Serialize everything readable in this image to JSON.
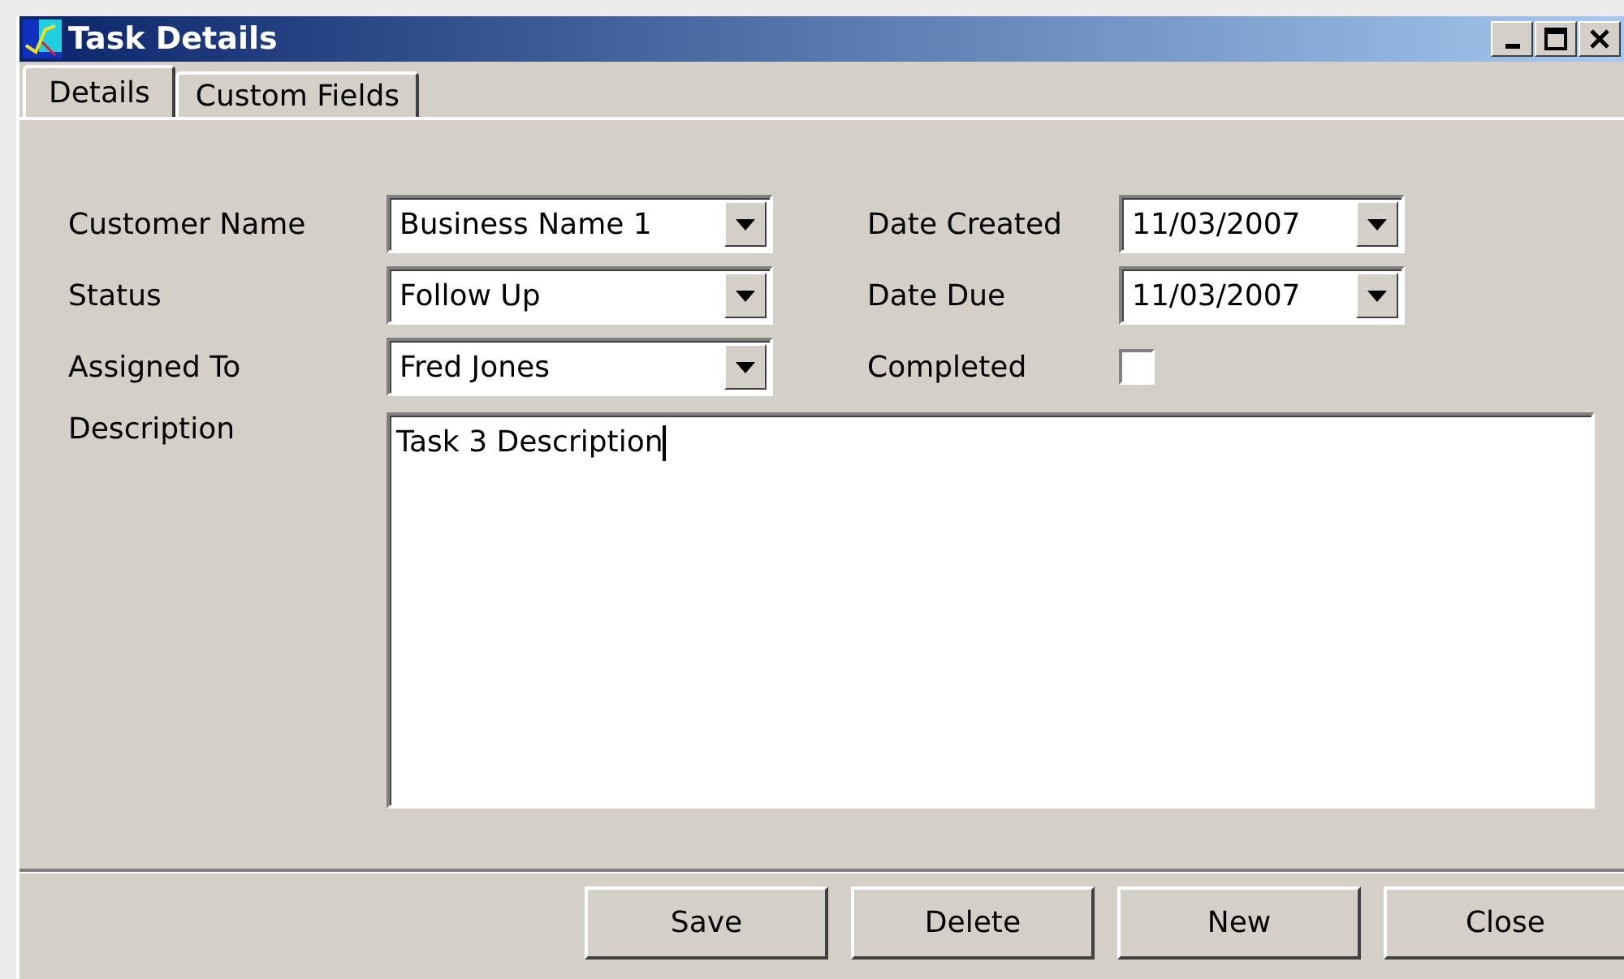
{
  "window": {
    "title": "Task Details"
  },
  "tabs": [
    {
      "label": "Details",
      "selected": true
    },
    {
      "label": "Custom Fields",
      "selected": false
    }
  ],
  "form": {
    "left": [
      {
        "label": "Customer Name",
        "value": "Business Name 1"
      },
      {
        "label": "Status",
        "value": "Follow Up"
      },
      {
        "label": "Assigned To",
        "value": "Fred Jones"
      }
    ],
    "right": [
      {
        "kind": "combo",
        "label": "Date Created",
        "value": "11/03/2007"
      },
      {
        "kind": "combo",
        "label": "Date Due",
        "value": "11/03/2007"
      },
      {
        "kind": "checkbox",
        "label": "Completed",
        "checked": false
      }
    ],
    "description": {
      "label": "Description",
      "value": "Task 3 Description"
    }
  },
  "buttons": [
    "Save",
    "Delete",
    "New",
    "Close"
  ]
}
